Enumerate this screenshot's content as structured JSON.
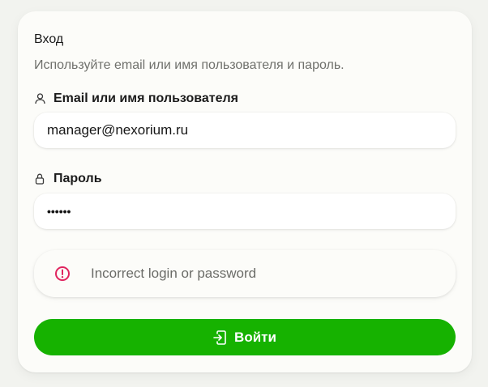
{
  "login_card": {
    "title": "Вход",
    "subtitle": "Используйте email или имя пользователя и пароль.",
    "email_field": {
      "label": "Email или имя пользователя",
      "value": "manager@nexorium.ru",
      "icon": "user-icon"
    },
    "password_field": {
      "label": "Пароль",
      "value": "••••••",
      "icon": "lock-icon"
    },
    "error_alert": {
      "message": "Incorrect login or password",
      "icon": "alert-circle-icon",
      "color": "#e0245e"
    },
    "submit_button": {
      "label": "Войти",
      "icon": "login-icon",
      "color": "#16b200"
    }
  }
}
